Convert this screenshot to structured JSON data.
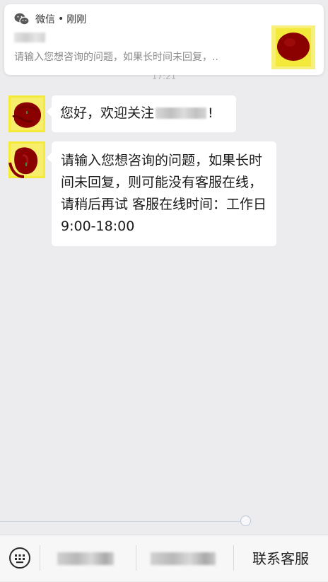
{
  "notification": {
    "app_name": "微信",
    "separator": "•",
    "time": "刚刚",
    "preview": "请输入您想咨询的问题，如果长时间未回复，.."
  },
  "chat": {
    "timestamp": "17:21",
    "messages": [
      {
        "prefix": "您好，欢迎关注",
        "suffix": "!"
      },
      {
        "text": "请输入您想咨询的问题，如果长时间未回复，则可能没有客服在线，请稍后再试 客服在线时间：工作日 9:00-18:00"
      }
    ]
  },
  "bottom_menu": {
    "keyboard_icon": "keyboard-icon",
    "contact_label": "联系客服"
  },
  "colors": {
    "background": "#ececee",
    "bubble": "#ffffff",
    "avatar_mark": "#8b0000",
    "avatar_highlight": "#f3ea3a"
  }
}
